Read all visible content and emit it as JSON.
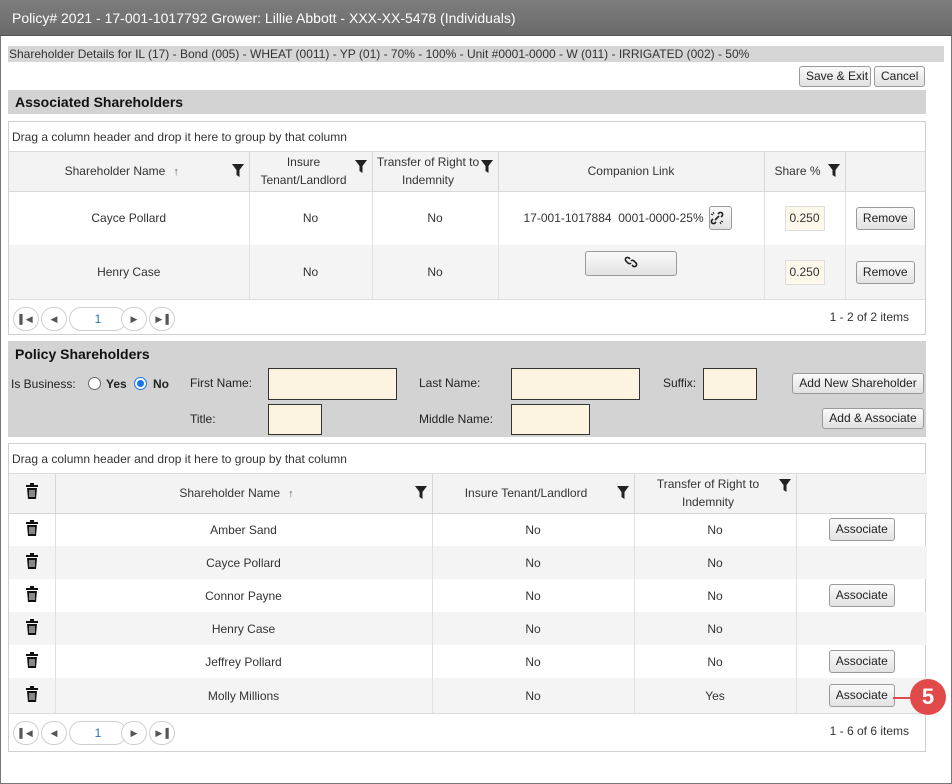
{
  "window": {
    "title": "Policy# 2021 - 17-001-1017792 Grower: Lillie Abbott - XXX-XX-5478 (Individuals)"
  },
  "details": "Shareholder Details for IL (17) - Bond (005) - WHEAT (0011) - YP (01) - 70% - 100% - Unit #0001-0000 - W (011) - IRRIGATED (002) - 50%",
  "toolbar": {
    "save_exit": "Save & Exit",
    "cancel": "Cancel"
  },
  "associated": {
    "title": "Associated Shareholders",
    "group_hint": "Drag a column header and drop it here to group by that column",
    "columns": {
      "name": "Shareholder Name",
      "insure": "Insure Tenant/Landlord",
      "transfer": "Transfer of Right to Indemnity",
      "companion": "Companion Link",
      "share": "Share %"
    },
    "rows": [
      {
        "name": "Cayce Pollard",
        "insure": "No",
        "transfer": "No",
        "companion": "17-001-1017884  0001-0000-25%",
        "share": "0.250",
        "action": "Remove"
      },
      {
        "name": "Henry Case",
        "insure": "No",
        "transfer": "No",
        "companion": "",
        "share": "0.250",
        "action": "Remove"
      }
    ],
    "pager": {
      "page": "1",
      "info": "1 - 2 of 2 items"
    }
  },
  "policy": {
    "title": "Policy Shareholders",
    "is_business_label": "Is Business:",
    "yes_label": "Yes",
    "no_label": "No",
    "is_business": false,
    "first_name_label": "First Name:",
    "last_name_label": "Last Name:",
    "suffix_label": "Suffix:",
    "title_label": "Title:",
    "middle_name_label": "Middle Name:",
    "add_new": "Add New Shareholder",
    "add_associate": "Add & Associate",
    "group_hint": "Drag a column header and drop it here to group by that column",
    "columns": {
      "name": "Shareholder Name",
      "insure": "Insure Tenant/Landlord",
      "transfer": "Transfer of Right to Indemnity"
    },
    "rows": [
      {
        "name": "Amber Sand",
        "insure": "No",
        "transfer": "No",
        "action": "Associate"
      },
      {
        "name": "Cayce Pollard",
        "insure": "No",
        "transfer": "No",
        "action": ""
      },
      {
        "name": "Connor Payne",
        "insure": "No",
        "transfer": "No",
        "action": "Associate"
      },
      {
        "name": "Henry Case",
        "insure": "No",
        "transfer": "No",
        "action": ""
      },
      {
        "name": "Jeffrey Pollard",
        "insure": "No",
        "transfer": "No",
        "action": "Associate"
      },
      {
        "name": "Molly Millions",
        "insure": "No",
        "transfer": "Yes",
        "action": "Associate"
      }
    ],
    "pager": {
      "page": "1",
      "info": "1 - 6 of 6 items"
    }
  },
  "callout": {
    "number": "5"
  },
  "colors": {
    "callout": "#e04a4a",
    "field": "#fdf3e1",
    "radio": "#1a73e8",
    "link": "#2a6ebb"
  }
}
